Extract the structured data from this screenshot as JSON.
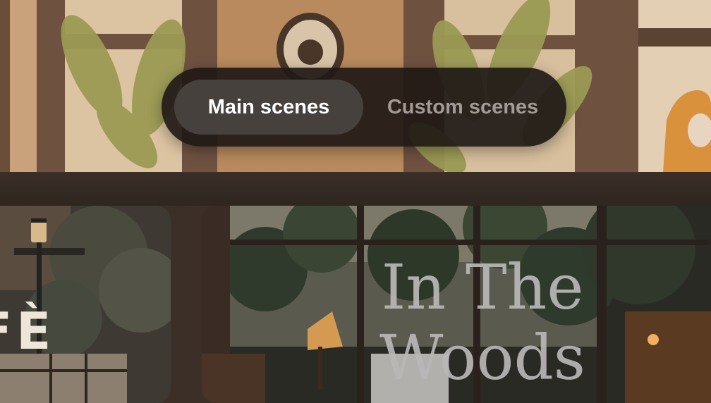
{
  "tabs": {
    "main": "Main scenes",
    "custom": "Custom scenes",
    "active": "main"
  },
  "scenes": [
    {
      "title_fragment": "FÈ"
    },
    {
      "title_line1": "In The",
      "title_line2": "Woods"
    }
  ],
  "colors": {
    "tab_bar_bg": "#201916",
    "tab_active_bg": "#47413d",
    "tab_active_text": "#ffffff",
    "tab_inactive_text": "#a29a95"
  }
}
